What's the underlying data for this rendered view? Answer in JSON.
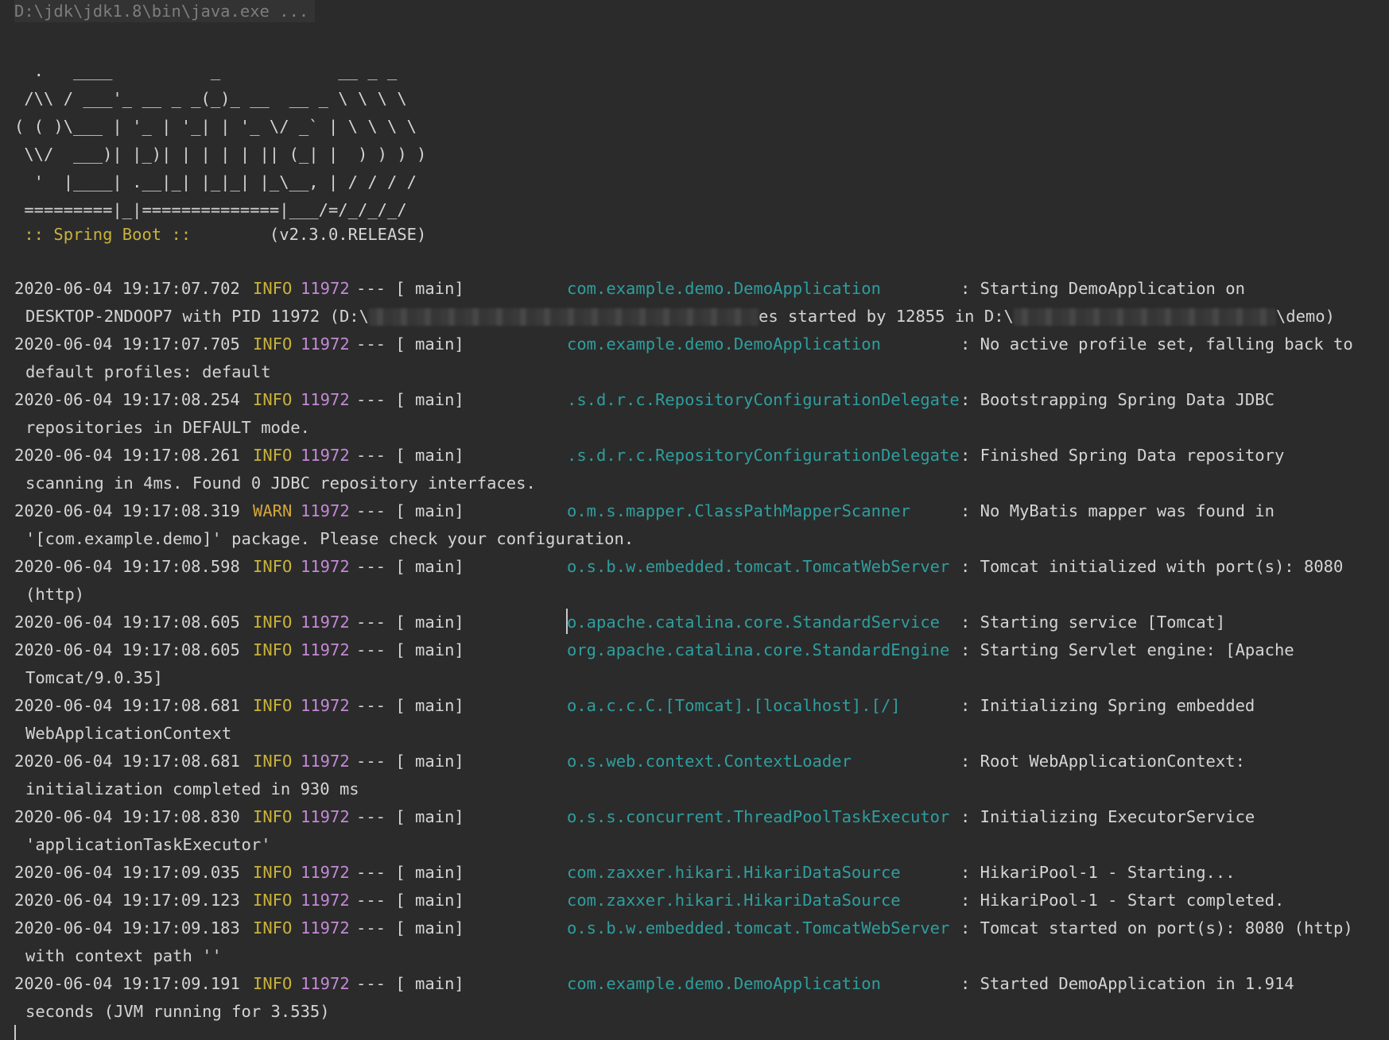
{
  "command": "D:\\jdk\\jdk1.8\\bin\\java.exe ...",
  "banner": [
    "  .   ____          _            __ _ _",
    " /\\\\ / ___'_ __ _ _(_)_ __  __ _ \\ \\ \\ \\",
    "( ( )\\___ | '_ | '_| | '_ \\/ _` | \\ \\ \\ \\",
    " \\\\/  ___)| |_)| | | | | || (_| |  ) ) ) )",
    "  '  |____| .__|_| |_|_| |_\\__, | / / / /",
    " =========|_|==============|___/=/_/_/_/"
  ],
  "boot": {
    "label": " :: Spring Boot :: ",
    "version": "       (v2.3.0.RELEASE)"
  },
  "colors": {
    "background": "#2b2b2b",
    "text": "#d4d4d4",
    "level_info": "#c9b23a",
    "pid": "#c389d6",
    "logger": "#2f9e9e"
  },
  "log": [
    {
      "ts": "2020-06-04 19:17:07.702",
      "level": "INFO",
      "pid": "11972",
      "thread": "--- [           main]",
      "logger": "com.example.demo.DemoApplication",
      "msg": ": Starting DemoApplication on",
      "cont": "DESKTOP-2NDOOP7 with PID 11972 (D:\\",
      "cont_mid": "es started by 12855 in D:\\",
      "cont_end": "\\demo)",
      "redacted": true
    },
    {
      "ts": "2020-06-04 19:17:07.705",
      "level": "INFO",
      "pid": "11972",
      "thread": "--- [           main]",
      "logger": "com.example.demo.DemoApplication",
      "msg": ": No active profile set, falling back to",
      "cont": "default profiles: default"
    },
    {
      "ts": "2020-06-04 19:17:08.254",
      "level": "INFO",
      "pid": "11972",
      "thread": "--- [           main]",
      "logger": ".s.d.r.c.RepositoryConfigurationDelegate",
      "msg": ": Bootstrapping Spring Data JDBC",
      "cont": "repositories in DEFAULT mode."
    },
    {
      "ts": "2020-06-04 19:17:08.261",
      "level": "INFO",
      "pid": "11972",
      "thread": "--- [           main]",
      "logger": ".s.d.r.c.RepositoryConfigurationDelegate",
      "msg": ": Finished Spring Data repository",
      "cont": "scanning in 4ms. Found 0 JDBC repository interfaces."
    },
    {
      "ts": "2020-06-04 19:17:08.319",
      "level": "WARN",
      "pid": "11972",
      "thread": "--- [           main]",
      "logger": "o.m.s.mapper.ClassPathMapperScanner",
      "msg": ": No MyBatis mapper was found in",
      "cont": "'[com.example.demo]' package. Please check your configuration."
    },
    {
      "ts": "2020-06-04 19:17:08.598",
      "level": "INFO",
      "pid": "11972",
      "thread": "--- [           main]",
      "logger": "o.s.b.w.embedded.tomcat.TomcatWebServer",
      "msg": ": Tomcat initialized with port(s): 8080",
      "cont": "(http)"
    },
    {
      "ts": "2020-06-04 19:17:08.605",
      "level": "INFO",
      "pid": "11972",
      "thread": "--- [           main]",
      "logger": "o.apache.catalina.core.StandardService",
      "msg": ": Starting service [Tomcat]"
    },
    {
      "ts": "2020-06-04 19:17:08.605",
      "level": "INFO",
      "pid": "11972",
      "thread": "--- [           main]",
      "logger": "org.apache.catalina.core.StandardEngine",
      "msg": ": Starting Servlet engine: [Apache",
      "cont": "Tomcat/9.0.35]"
    },
    {
      "ts": "2020-06-04 19:17:08.681",
      "level": "INFO",
      "pid": "11972",
      "thread": "--- [           main]",
      "logger": "o.a.c.c.C.[Tomcat].[localhost].[/]",
      "msg": ": Initializing Spring embedded",
      "cont": "WebApplicationContext"
    },
    {
      "ts": "2020-06-04 19:17:08.681",
      "level": "INFO",
      "pid": "11972",
      "thread": "--- [           main]",
      "logger": "o.s.web.context.ContextLoader",
      "msg": ": Root WebApplicationContext:",
      "cont": "initialization completed in 930 ms"
    },
    {
      "ts": "2020-06-04 19:17:08.830",
      "level": "INFO",
      "pid": "11972",
      "thread": "--- [           main]",
      "logger": "o.s.s.concurrent.ThreadPoolTaskExecutor",
      "msg": ": Initializing ExecutorService",
      "cont": "'applicationTaskExecutor'"
    },
    {
      "ts": "2020-06-04 19:17:09.035",
      "level": "INFO",
      "pid": "11972",
      "thread": "--- [           main]",
      "logger": "com.zaxxer.hikari.HikariDataSource",
      "msg": ": HikariPool-1 - Starting..."
    },
    {
      "ts": "2020-06-04 19:17:09.123",
      "level": "INFO",
      "pid": "11972",
      "thread": "--- [           main]",
      "logger": "com.zaxxer.hikari.HikariDataSource",
      "msg": ": HikariPool-1 - Start completed."
    },
    {
      "ts": "2020-06-04 19:17:09.183",
      "level": "INFO",
      "pid": "11972",
      "thread": "--- [           main]",
      "logger": "o.s.b.w.embedded.tomcat.TomcatWebServer",
      "msg": ": Tomcat started on port(s): 8080 (http)",
      "cont": "with context path ''"
    },
    {
      "ts": "2020-06-04 19:17:09.191",
      "level": "INFO",
      "pid": "11972",
      "thread": "--- [           main]",
      "logger": "com.example.demo.DemoApplication",
      "msg": ": Started DemoApplication in 1.914",
      "cont": "seconds (JVM running for 3.535)"
    }
  ]
}
